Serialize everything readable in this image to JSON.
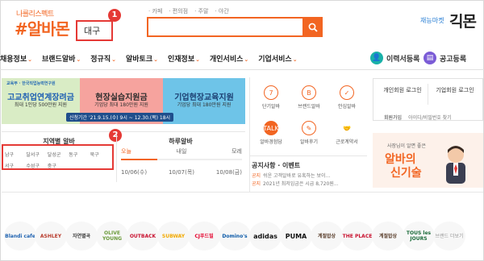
{
  "header": {
    "logo_slogan": "나를리스펙트",
    "logo_text": "#알바몬",
    "region": "대구",
    "quick_tags": [
      "카페",
      "편의점",
      "주말",
      "야간"
    ],
    "search_placeholder": "",
    "market_label": "재능마켓",
    "market_logo": "긱몬",
    "callout_1": "1",
    "callout_2": "2"
  },
  "nav": {
    "items": [
      {
        "label": "채용정보"
      },
      {
        "label": "브랜드알바"
      },
      {
        "label": "정규직"
      },
      {
        "label": "알바토크"
      },
      {
        "label": "인재정보"
      },
      {
        "label": "개인서비스"
      },
      {
        "label": "기업서비스"
      }
    ],
    "resume_label": "이력서등록",
    "job_post_label": "공고등록"
  },
  "banner": {
    "logo_text": "교육부 · 한국직업능력연구원",
    "seg1_title": "고교취업연계장려금",
    "seg1_sub": "최대 1인당 500만원 지원",
    "seg2_title": "현장실습지원금",
    "seg2_sub": "기업당 최대 180만원 지원",
    "seg3_title": "기업현장교육지원",
    "seg3_sub": "기업당 최대 180만원 지원",
    "dates": "신청기간 '21.9.15.(수) 9시 ~ 12.30.(목) 18시"
  },
  "area_job": {
    "title": "지역별 알바",
    "districts": [
      "남구",
      "달서구",
      "달성군",
      "동구",
      "북구",
      "서구",
      "수성구",
      "중구"
    ]
  },
  "daily_job": {
    "title": "하루알바",
    "tabs": [
      "오늘",
      "내일",
      "모레"
    ],
    "dates": [
      "10/06(수)",
      "10/07(목)",
      "10/08(금)"
    ]
  },
  "services": [
    {
      "label": "단기알바",
      "icon": "calendar-icon"
    },
    {
      "label": "브랜드알바",
      "icon": "brand-b-icon"
    },
    {
      "label": "안심알바",
      "icon": "shield-check-icon"
    },
    {
      "label": "알바경험담",
      "icon": "talk-icon"
    },
    {
      "label": "알바후기",
      "icon": "pencil-icon"
    },
    {
      "label": "근로계약서",
      "icon": "handshake-icon"
    }
  ],
  "notice": {
    "title": "공지사항 · 이벤트",
    "items": [
      {
        "tag": "공지",
        "text": "쉬운 고객알바로 유혹하는 보이..."
      },
      {
        "tag": "공지",
        "text": "2021년 최저임금은 시급 8,720원..."
      }
    ]
  },
  "login": {
    "personal": "개인회원 로그인",
    "company": "기업회원 로그인",
    "join": "회원가입",
    "find": "아이디/비밀번호 찾기"
  },
  "promo": {
    "small": "사장님이 알면 좋은",
    "big1": "알바의",
    "big2": "신기술"
  },
  "brands": [
    "Blandi cafe",
    "ASHLEY",
    "자연별곡",
    "OLIVE YOUNG",
    "OUTBACK",
    "SUBWAY",
    "CJ푸드빌",
    "Domino's",
    "adidas",
    "PUMA",
    "계절밥상",
    "THE PLACE",
    "계절밥상",
    "TOUS les JOURS",
    "브랜드 더보기"
  ],
  "colors": {
    "brand_orange": "#f26522",
    "callout_red": "#e53935",
    "resume_teal": "#19b1a8",
    "post_purple": "#7b5cd6"
  }
}
